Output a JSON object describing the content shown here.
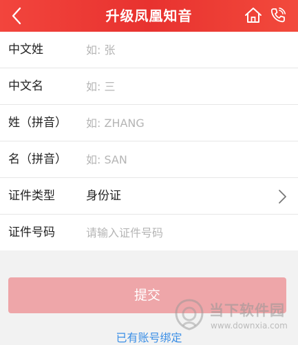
{
  "navbar": {
    "title": "升级凤凰知音",
    "back_icon": "chevron-left-icon",
    "home_icon": "home-icon",
    "phone_icon": "phone-icon"
  },
  "form": {
    "rows": [
      {
        "label": "中文姓",
        "placeholder": "如: 张",
        "value": ""
      },
      {
        "label": "中文名",
        "placeholder": "如: 三",
        "value": ""
      },
      {
        "label": "姓（拼音）",
        "placeholder": "如: ZHANG",
        "value": ""
      },
      {
        "label": "名（拼音）",
        "placeholder": "如: SAN",
        "value": ""
      },
      {
        "label": "证件类型",
        "value": "身份证"
      },
      {
        "label": "证件号码",
        "placeholder": "请输入证件号码",
        "value": ""
      }
    ]
  },
  "submit_label": "提交",
  "account_link": "已有账号绑定",
  "watermark": {
    "name": "当下软件园",
    "url": "www.downxia.com"
  },
  "colors": {
    "navbar": "#e8322f",
    "submit_disabled": "#eea6a9",
    "link": "#3a8ee6"
  }
}
